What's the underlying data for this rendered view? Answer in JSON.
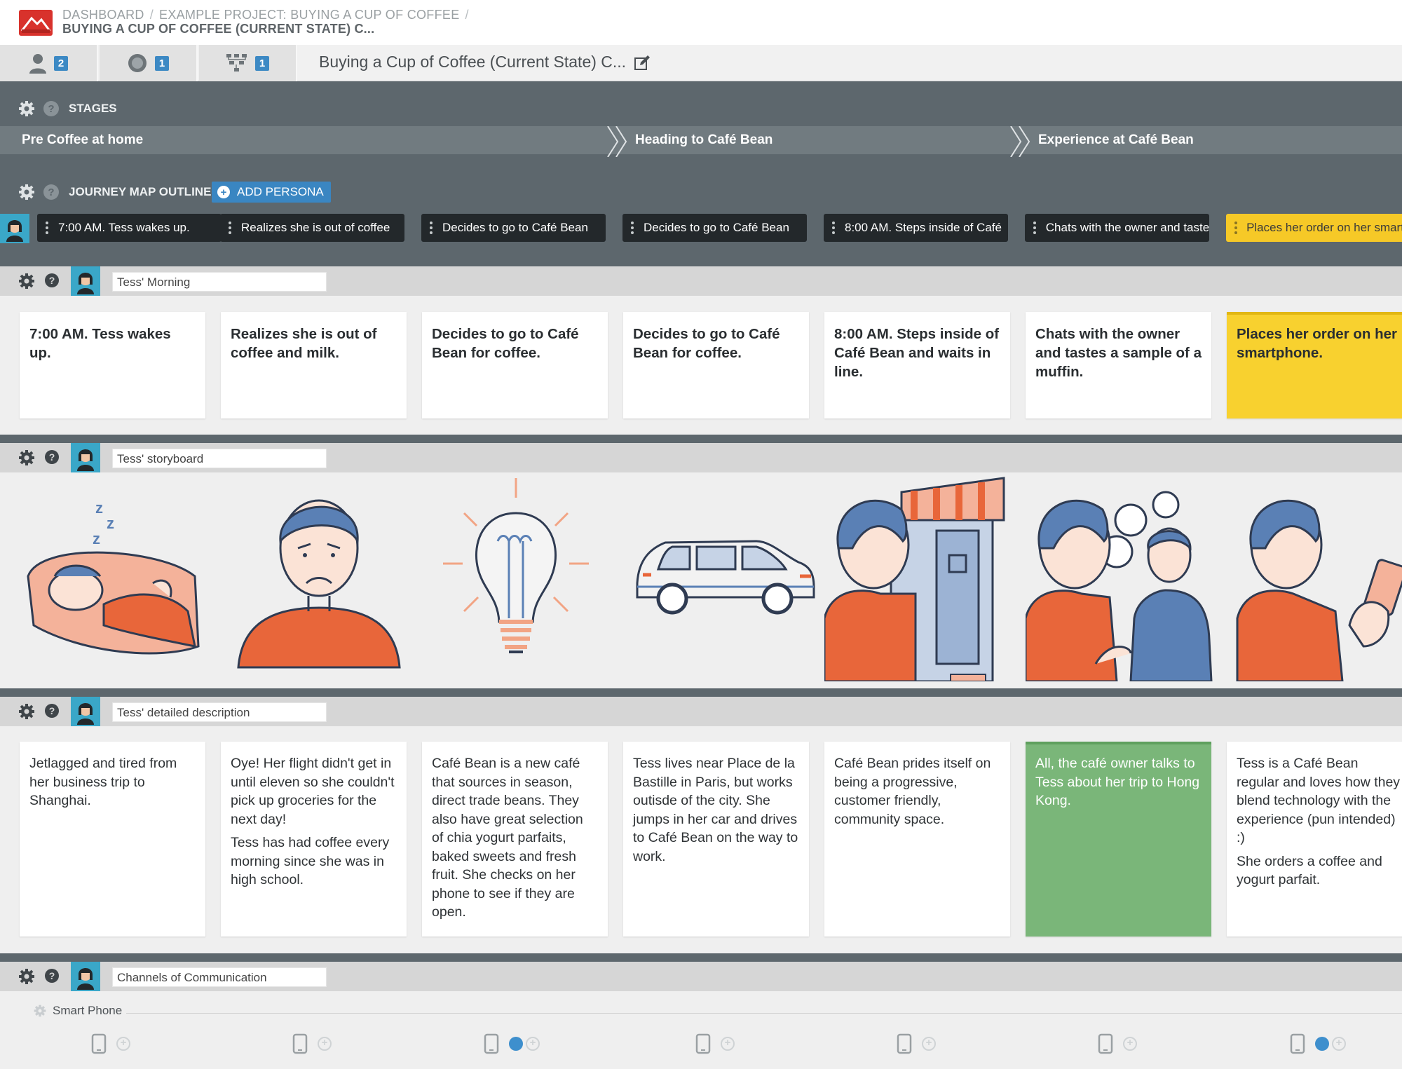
{
  "breadcrumb": {
    "items": [
      "DASHBOARD",
      "EXAMPLE PROJECT: BUYING A CUP OF COFFEE"
    ],
    "separator": "/",
    "current": "BUYING A CUP OF COFFEE (CURRENT STATE) C..."
  },
  "tabs": [
    {
      "icon": "persona-icon",
      "count": "2"
    },
    {
      "icon": "touchpoint-icon",
      "count": "1"
    },
    {
      "icon": "hierarchy-icon",
      "count": "1"
    }
  ],
  "document": {
    "title": "Buying a Cup of Coffee (Current State) C..."
  },
  "stages": {
    "heading": "STAGES",
    "items": [
      "Pre Coffee at home",
      "Heading to Café Bean",
      "Experience at Café Bean"
    ]
  },
  "outline": {
    "heading": "JOURNEY MAP OUTLINE",
    "add_persona_label": "ADD PERSONA",
    "steps": [
      "7:00 AM. Tess wakes up.",
      "Realizes she is out of coffee",
      "Decides to go to Café Bean",
      "Decides to go to Café Bean",
      "8:00 AM. Steps inside of Café",
      "Chats with the owner and tastes",
      "Places her order on her smartphone."
    ]
  },
  "lanes": {
    "morning": {
      "title": "Tess' Morning",
      "cards": [
        "7:00 AM. Tess wakes up.",
        "Realizes she is out of coffee and milk.",
        "Decides to go to Café Bean for coffee.",
        "Decides to go to Café Bean for coffee.",
        "8:00 AM. Steps inside of Café Bean and waits in line.",
        "Chats with the owner and tastes a sample of a muffin.",
        "Places her order on her smartphone."
      ]
    },
    "storyboard": {
      "title": "Tess' storyboard",
      "frames": [
        "sleeping-illustration",
        "sad-face-illustration",
        "lightbulb-illustration",
        "car-illustration",
        "storefront-illustration",
        "conversation-illustration",
        "smartphone-illustration"
      ]
    },
    "description": {
      "title": "Tess' detailed description",
      "cards": [
        [
          "Jetlagged and tired from her business trip to Shanghai."
        ],
        [
          "Oye! Her flight didn't get in until eleven so she couldn't pick up groceries for the next day!",
          "Tess has had coffee every morning since she was in high school."
        ],
        [
          "Café Bean is a new café that sources in season, direct trade beans. They also have great selection of chia yogurt parfaits, baked sweets and fresh fruit. She checks on her phone to see if they are open."
        ],
        [
          "Tess lives near Place de la Bastille in Paris, but works outisde of the city. She jumps in her car and drives to Café Bean on the way to work."
        ],
        [
          "Café Bean prides itself on being a progressive, customer friendly, community space."
        ],
        [
          "All, the café owner talks to Tess about her trip to Hong Kong."
        ],
        [
          "Tess is a Café Bean regular and loves how they blend technology with the experience (pun intended) :)",
          "She orders a coffee and yogurt parfait."
        ]
      ]
    },
    "channels": {
      "title": "Channels of Communication",
      "channel_name": "Smart Phone",
      "active": [
        false,
        false,
        true,
        false,
        false,
        false,
        true
      ]
    }
  },
  "colors": {
    "accent_blue": "#3a86c2",
    "stage_bg": "#5d676d",
    "highlight_yellow": "#f8d12f",
    "highlight_green": "#7ab679",
    "illustration_orange": "#e8663a",
    "illustration_blue": "#5a80b5"
  }
}
